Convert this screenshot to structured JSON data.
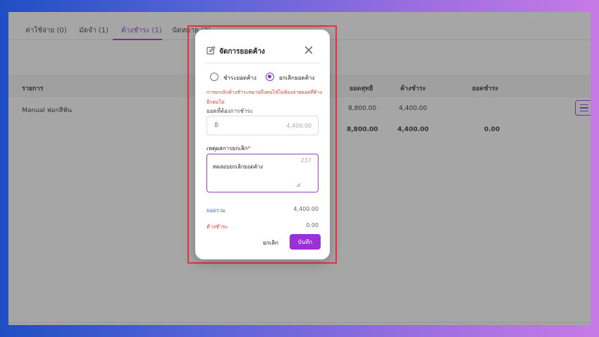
{
  "tabs": [
    {
      "label": "ค่าใช้จ่าย (0)"
    },
    {
      "label": "มัดจำ (1)"
    },
    {
      "label": "ค้างชำระ (1)"
    },
    {
      "label": "นัดหมาย (0)"
    }
  ],
  "table": {
    "headers": {
      "item": "รายการ",
      "net": "ยอดสุทธิ",
      "outstanding": "ค้างชำระ",
      "paid": "ยอดชำระ"
    },
    "row": {
      "item": "Manual ฟอกสีฟัน",
      "net": "8,800.00",
      "outstanding": "4,400.00"
    },
    "totals": {
      "net": "8,800.00",
      "outstanding": "4,400.00",
      "paid": "0.00"
    }
  },
  "modal": {
    "title": "จัดการยอดค้าง",
    "option_pay": "ชำระยอดค้าง",
    "option_cancel": "ยกเลิกยอดค้าง",
    "selected_option": "cancel",
    "warning": "การยกเลิกค้างชำระหมายถึงคนไข้ไม่ต้องจ่ายยอดที่ค้างอีกต่อไป",
    "amount_label": "ยอดที่ต้องการชำระ",
    "currency_symbol": "฿",
    "amount_value": "4,400.00",
    "reason_label": "เหตุผลการยกเลิก",
    "required_mark": "*",
    "reason_value": "ทดสอบยกเลิกยอดค้าง",
    "char_counter": "237",
    "total_label": "ยอดรวม",
    "total_value": "4,400.00",
    "outstanding_label": "ค้างชำระ",
    "outstanding_value": "0.00",
    "cancel_button": "ยกเลิก",
    "save_button": "บันทึก"
  },
  "colors": {
    "accent": "#8a2fc9",
    "warning": "#e03a3a",
    "total_label": "#3b6fd8",
    "highlight_border": "#e0383a"
  },
  "icons": {
    "title": "edit-icon",
    "close": "close-icon",
    "menu": "hamburger-menu-icon",
    "currency": "baht-icon"
  }
}
